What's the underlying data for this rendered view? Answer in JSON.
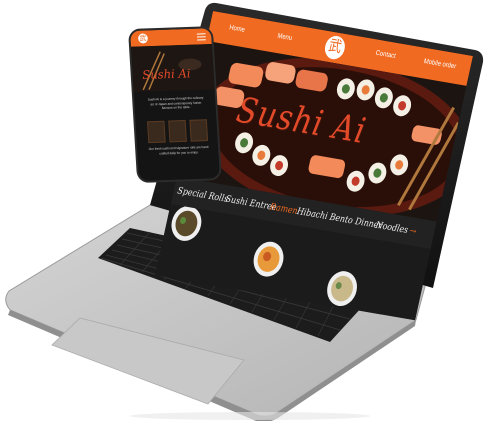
{
  "laptop_site": {
    "nav": {
      "home": "Home",
      "menu": "Menu",
      "contact": "Contact",
      "mobile_order": "Mobile order",
      "logo_glyph": "武"
    },
    "hero": {
      "title": "Sushi Ai"
    },
    "tabs": [
      {
        "label": "Special Rolls"
      },
      {
        "label": "Sushi Entree"
      },
      {
        "label": "Ramen"
      },
      {
        "label": "Hibachi"
      },
      {
        "label": "Bento Dinner"
      },
      {
        "label": "Noodles"
      }
    ],
    "active_tab": "Ramen",
    "next_arrow": "→"
  },
  "phone_site": {
    "logo_glyph": "武",
    "hero": {
      "title": "Sushi Ai"
    },
    "paragraph_1": "Sushi Ai is a journey through the culinary art of Japan and contemporary fusion flavours on the table.",
    "paragraph_2": "Our fresh sushi and signature rolls are hand crafted daily for you to enjoy."
  },
  "colors": {
    "brand_orange": "#f06a21",
    "title_red": "#e24a2a",
    "laptop_silver": "#bdbdbd",
    "screen_dark": "#1a1a1a"
  }
}
